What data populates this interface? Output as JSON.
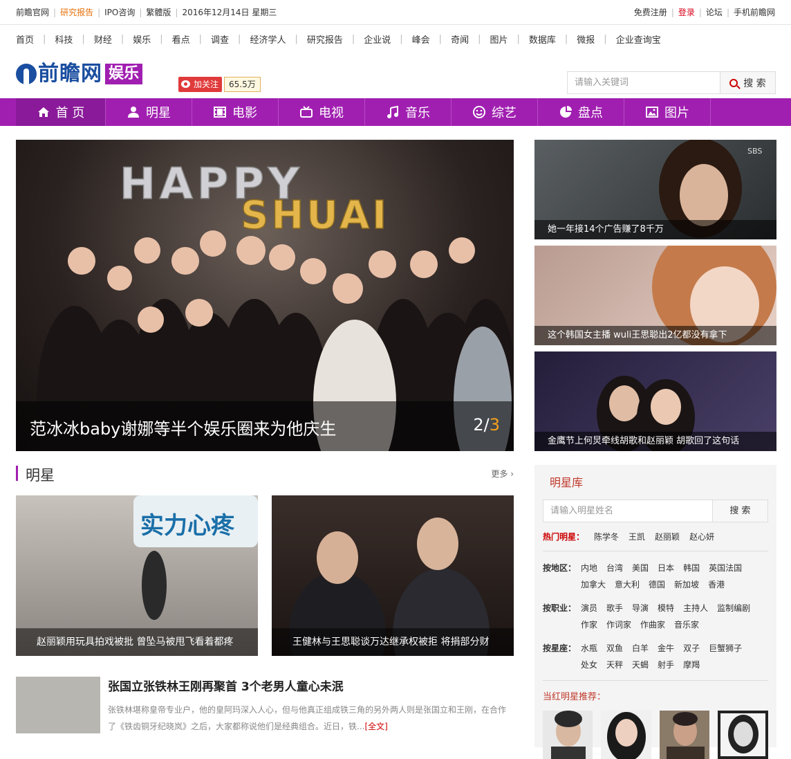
{
  "topbar": {
    "left": [
      "前瞻官网",
      "研究报告",
      "IPO咨询",
      "繁體版",
      "2016年12月14日 星期三"
    ],
    "right": [
      "免费注册",
      "登录",
      "论坛",
      "手机前瞻网"
    ]
  },
  "nav": [
    "首页",
    "科技",
    "财经",
    "娱乐",
    "看点",
    "调查",
    "经济学人",
    "研究报告",
    "企业说",
    "峰会",
    "奇闻",
    "图片",
    "数据库",
    "微报",
    "企业查询宝"
  ],
  "brand": {
    "name": "前瞻网",
    "channel": "娱乐",
    "follow": "加关注",
    "followers": "65.5万"
  },
  "search": {
    "placeholder": "请输入关键词",
    "button": "搜 索"
  },
  "mainnav": [
    {
      "label": "首 页",
      "icon": "home-icon"
    },
    {
      "label": "明星",
      "icon": "person-icon"
    },
    {
      "label": "电影",
      "icon": "film-icon"
    },
    {
      "label": "电视",
      "icon": "tv-icon"
    },
    {
      "label": "音乐",
      "icon": "music-icon"
    },
    {
      "label": "综艺",
      "icon": "smile-icon"
    },
    {
      "label": "盘点",
      "icon": "pie-icon"
    },
    {
      "label": "图片",
      "icon": "image-icon"
    }
  ],
  "slider": {
    "caption": "范冰冰baby谢娜等半个娱乐圈来为他庆生",
    "current": "2",
    "total": "3",
    "photo_text": "HAPPY SHUAI"
  },
  "side": [
    "她一年接14个广告赚了8千万",
    "这个韩国女主播 wuli王思聪出2亿都没有拿下",
    "金鹰节上何炅牵线胡歌和赵丽颖 胡歌回了这句话"
  ],
  "section": {
    "title": "明星",
    "more": "更多"
  },
  "tiles": [
    {
      "caption": "赵丽颖用玩具拍戏被批 曾坠马被甩飞看着都疼",
      "overlay": "实力心疼"
    },
    {
      "caption": "王健林与王思聪谈万达继承权被拒 将捐部分财"
    }
  ],
  "news": {
    "title": "张国立张铁林王刚再聚首 3个老男人童心未泯",
    "desc": "张铁林堪称皇帝专业户，他的皇阿玛深入人心，但与他真正组成铁三角的另外两人则是张国立和王刚，在合作了《铁齿铜牙纪晓岚》之后，大家都称说他们是经典组合。近日，铁...",
    "full": "[全文]"
  },
  "starbox": {
    "title": "明星库",
    "placeholder": "请输入明星姓名",
    "button": "搜 索",
    "hot_label": "热门明星：",
    "hot": [
      "陈学冬",
      "王凯",
      "赵丽颖",
      "赵心妍"
    ],
    "groups": [
      {
        "label": "按地区：",
        "items": [
          "内地",
          "台湾",
          "美国",
          "日本",
          "韩国",
          "英国",
          "法国",
          "加拿大",
          "意大利",
          "德国",
          "新加坡",
          "香港"
        ]
      },
      {
        "label": "按职业：",
        "items": [
          "演员",
          "歌手",
          "导演",
          "模特",
          "主持人",
          "监制",
          "编剧",
          "作家",
          "作词家",
          "作曲家",
          "音乐家"
        ]
      },
      {
        "label": "按星座：",
        "items": [
          "水瓶",
          "双鱼",
          "白羊",
          "金牛",
          "双子",
          "巨蟹",
          "狮子",
          "处女",
          "天秤",
          "天蝎",
          "射手",
          "摩羯"
        ]
      }
    ],
    "rec_label": "当红明星推荐："
  }
}
